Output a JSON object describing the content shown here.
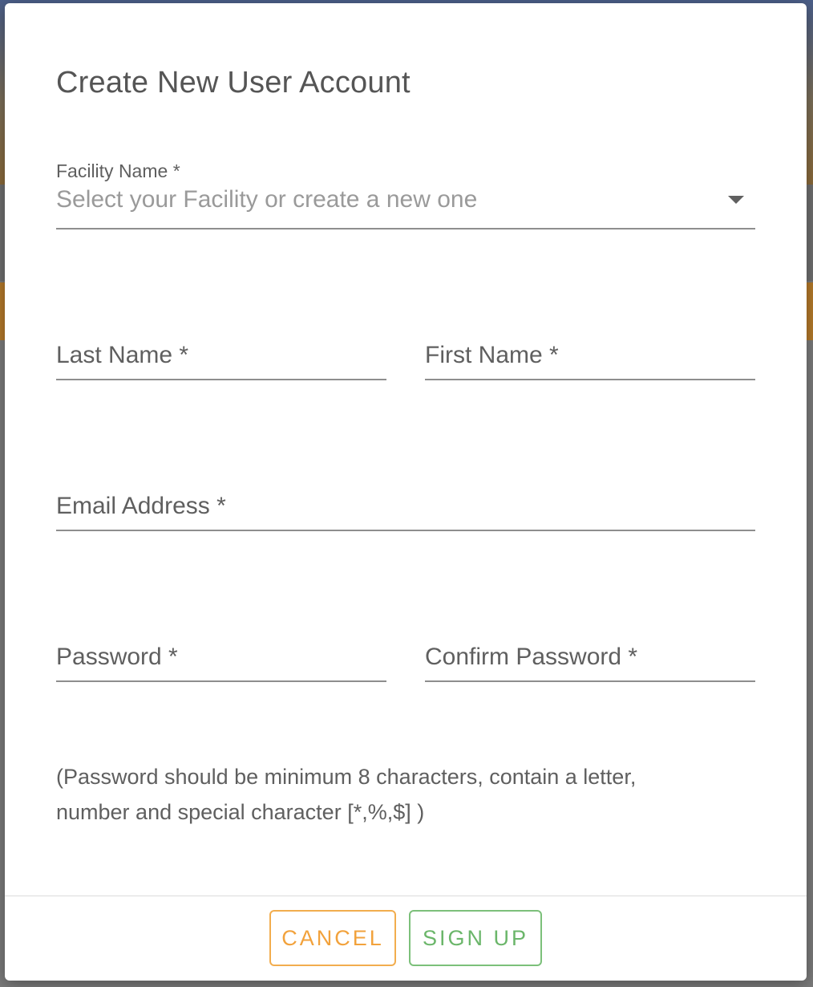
{
  "dialog": {
    "title": "Create New User Account",
    "facility": {
      "label": "Facility Name *",
      "placeholder": "Select your Facility or create a new one"
    },
    "last_name": {
      "label": "Last Name *"
    },
    "first_name": {
      "label": "First Name *"
    },
    "email": {
      "label": "Email Address *"
    },
    "password": {
      "label": "Password *"
    },
    "confirm_password": {
      "label": "Confirm Password *"
    },
    "password_hint": "(Password should be minimum 8 characters, contain a letter, number and special character [*,%,$] )",
    "buttons": {
      "cancel": "CANCEL",
      "sign_up": "SIGN UP"
    }
  },
  "colors": {
    "cancel_accent": "#f2a23c",
    "signup_accent": "#6bb66a",
    "text": "#5f5f5f",
    "placeholder": "#9a9a9a"
  },
  "icons": {
    "facility_dropdown": "caret-down-icon"
  }
}
